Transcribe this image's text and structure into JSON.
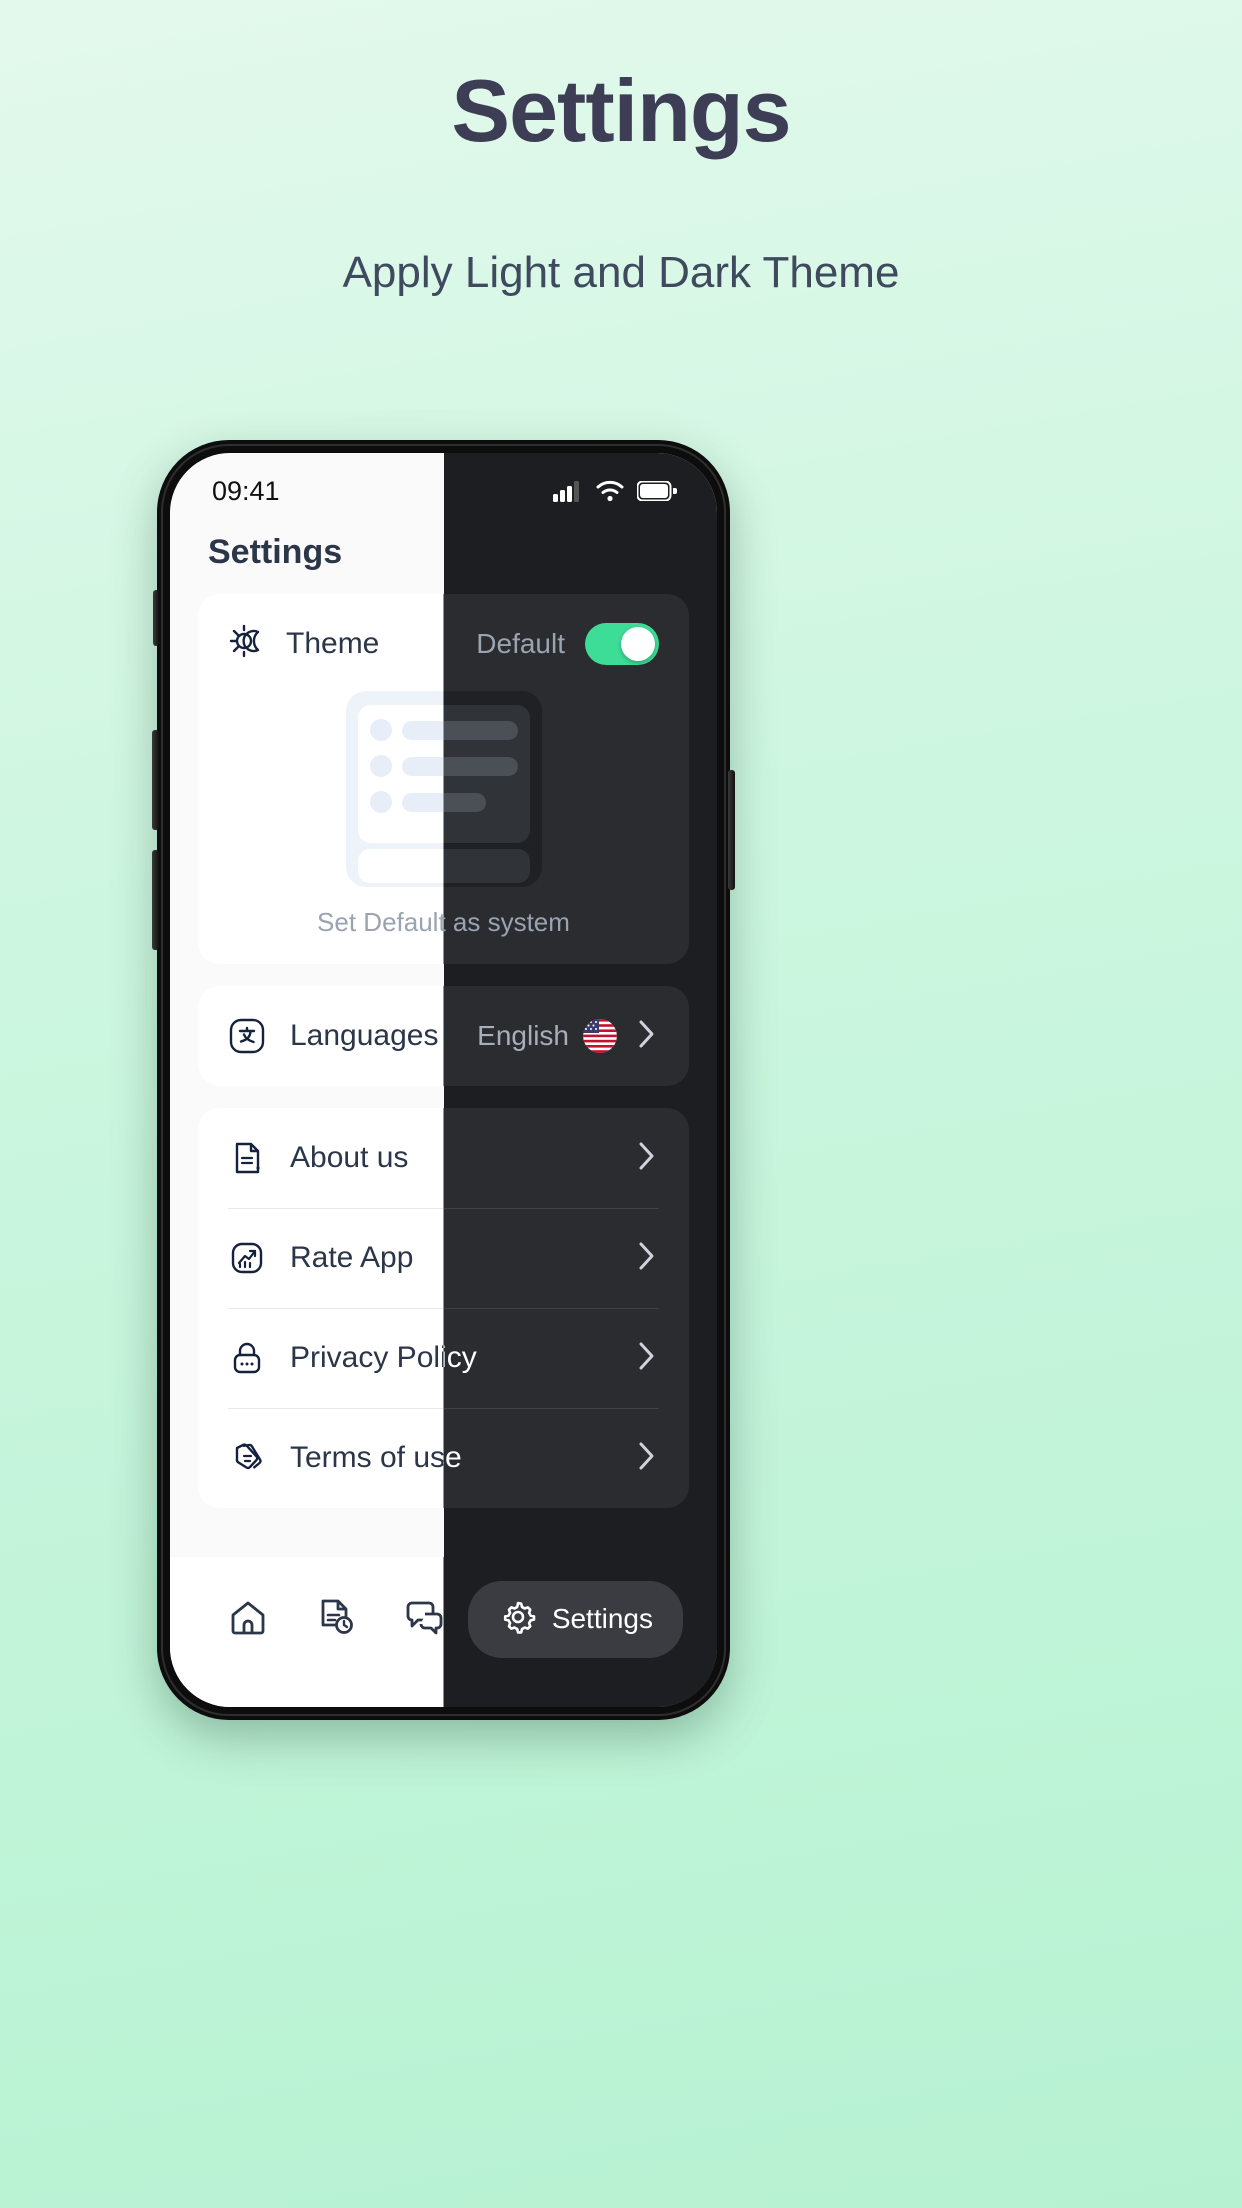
{
  "promo": {
    "title": "Settings",
    "subtitle": "Apply Light and Dark Theme"
  },
  "phone": {
    "status_bar": {
      "time": "09:41",
      "icons": [
        "cellular-signal-icon",
        "wifi-icon",
        "battery-icon"
      ]
    },
    "app_header": {
      "title": "Settings"
    },
    "theme_card": {
      "icon": "sun-moon-icon",
      "label": "Theme",
      "value": "Default",
      "toggle_on": true,
      "caption": "Set Default as system"
    },
    "menu": [
      {
        "icon": "translate-icon",
        "label": "Languages",
        "value": "English",
        "flag": "us-flag-icon",
        "chevron": "chevron-right-icon"
      },
      {
        "icon": "document-info-icon",
        "label": "About us",
        "value": "",
        "chevron": "chevron-right-icon"
      },
      {
        "icon": "chart-up-icon",
        "label": "Rate App",
        "value": "",
        "chevron": "chevron-right-icon"
      },
      {
        "icon": "lock-icon",
        "label": "Privacy Policy",
        "value": "",
        "chevron": "chevron-right-icon"
      },
      {
        "icon": "terms-cards-icon",
        "label": "Terms of use",
        "value": "",
        "chevron": "chevron-right-icon"
      }
    ],
    "bottom_nav": [
      {
        "icon": "home-icon",
        "label": ""
      },
      {
        "icon": "document-clock-icon",
        "label": ""
      },
      {
        "icon": "chat-bubbles-icon",
        "label": ""
      },
      {
        "icon": "gear-icon",
        "label": "Settings",
        "active": true
      }
    ]
  },
  "colors": {
    "accent_green": "#3ddc97",
    "dark_bg": "#1d1e21",
    "light_bg": "#fafafa",
    "text_dark": "#2b3648",
    "text_muted": "#9aa3b0"
  }
}
